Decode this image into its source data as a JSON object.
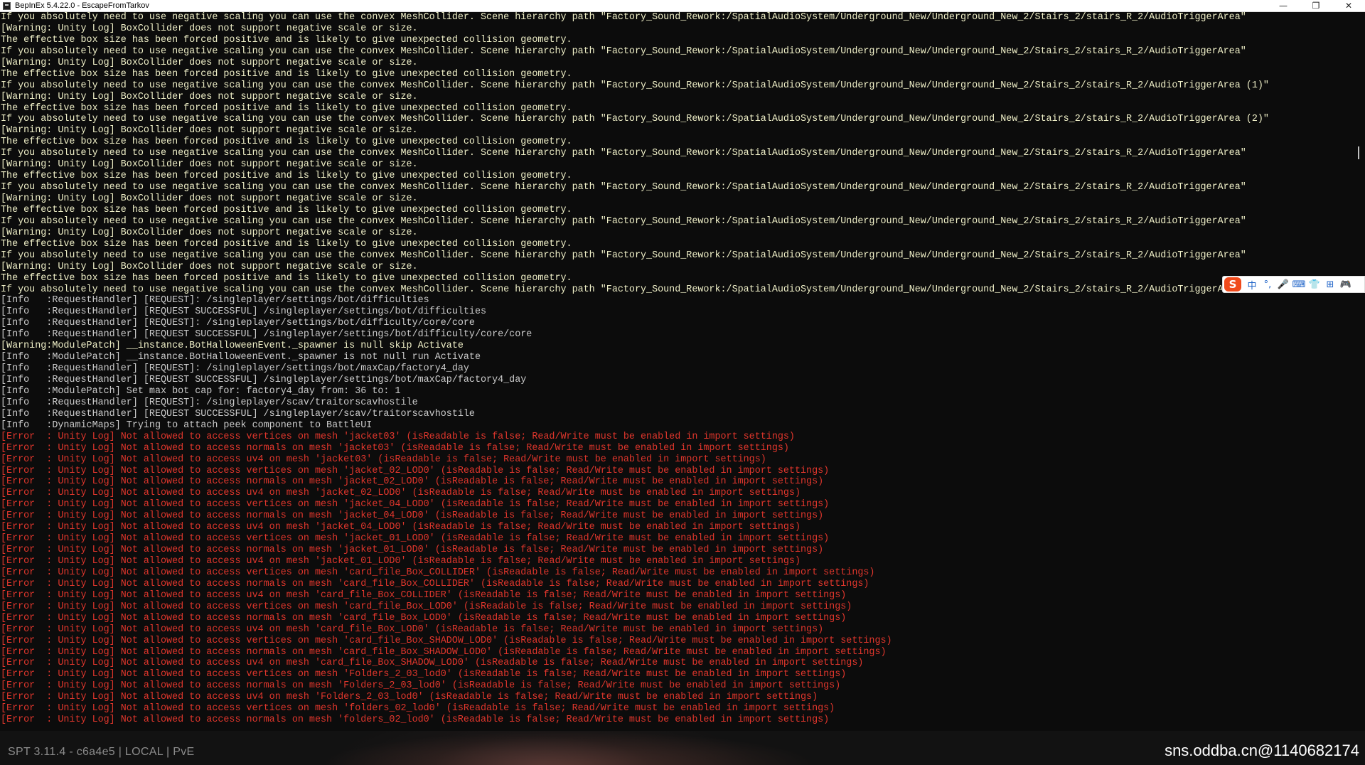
{
  "window": {
    "title": "BepInEx 5.4.22.0 - EscapeFromTarkov",
    "controls": {
      "minimize": "—",
      "restore": "❐",
      "close": "✕"
    }
  },
  "console_lines": [
    {
      "type": "warn",
      "text": "If you absolutely need to use negative scaling you can use the convex MeshCollider. Scene hierarchy path \"Factory_Sound_Rework:/SpatialAudioSystem/Underground_New/Underground_New_2/Stairs_2/stairs_R_2/AudioTriggerArea\""
    },
    {
      "type": "warn",
      "text": "[Warning: Unity Log] BoxCollider does not support negative scale or size."
    },
    {
      "type": "warn",
      "text": "The effective box size has been forced positive and is likely to give unexpected collision geometry."
    },
    {
      "type": "warn",
      "text": "If you absolutely need to use negative scaling you can use the convex MeshCollider. Scene hierarchy path \"Factory_Sound_Rework:/SpatialAudioSystem/Underground_New/Underground_New_2/Stairs_2/stairs_R_2/AudioTriggerArea\""
    },
    {
      "type": "warn",
      "text": "[Warning: Unity Log] BoxCollider does not support negative scale or size."
    },
    {
      "type": "warn",
      "text": "The effective box size has been forced positive and is likely to give unexpected collision geometry."
    },
    {
      "type": "warn",
      "text": "If you absolutely need to use negative scaling you can use the convex MeshCollider. Scene hierarchy path \"Factory_Sound_Rework:/SpatialAudioSystem/Underground_New/Underground_New_2/Stairs_2/stairs_R_2/AudioTriggerArea (1)\""
    },
    {
      "type": "warn",
      "text": "[Warning: Unity Log] BoxCollider does not support negative scale or size."
    },
    {
      "type": "warn",
      "text": "The effective box size has been forced positive and is likely to give unexpected collision geometry."
    },
    {
      "type": "warn",
      "text": "If you absolutely need to use negative scaling you can use the convex MeshCollider. Scene hierarchy path \"Factory_Sound_Rework:/SpatialAudioSystem/Underground_New/Underground_New_2/Stairs_2/stairs_R_2/AudioTriggerArea (2)\""
    },
    {
      "type": "warn",
      "text": "[Warning: Unity Log] BoxCollider does not support negative scale or size."
    },
    {
      "type": "warn",
      "text": "The effective box size has been forced positive and is likely to give unexpected collision geometry."
    },
    {
      "type": "warn",
      "text": "If you absolutely need to use negative scaling you can use the convex MeshCollider. Scene hierarchy path \"Factory_Sound_Rework:/SpatialAudioSystem/Underground_New/Underground_New_2/Stairs_2/stairs_R_2/AudioTriggerArea\""
    },
    {
      "type": "warn",
      "text": "[Warning: Unity Log] BoxCollider does not support negative scale or size."
    },
    {
      "type": "warn",
      "text": "The effective box size has been forced positive and is likely to give unexpected collision geometry."
    },
    {
      "type": "warn",
      "text": "If you absolutely need to use negative scaling you can use the convex MeshCollider. Scene hierarchy path \"Factory_Sound_Rework:/SpatialAudioSystem/Underground_New/Underground_New_2/Stairs_2/stairs_R_2/AudioTriggerArea\""
    },
    {
      "type": "warn",
      "text": "[Warning: Unity Log] BoxCollider does not support negative scale or size."
    },
    {
      "type": "warn",
      "text": "The effective box size has been forced positive and is likely to give unexpected collision geometry."
    },
    {
      "type": "warn",
      "text": "If you absolutely need to use negative scaling you can use the convex MeshCollider. Scene hierarchy path \"Factory_Sound_Rework:/SpatialAudioSystem/Underground_New/Underground_New_2/Stairs_2/stairs_R_2/AudioTriggerArea\""
    },
    {
      "type": "warn",
      "text": "[Warning: Unity Log] BoxCollider does not support negative scale or size."
    },
    {
      "type": "warn",
      "text": "The effective box size has been forced positive and is likely to give unexpected collision geometry."
    },
    {
      "type": "warn",
      "text": "If you absolutely need to use negative scaling you can use the convex MeshCollider. Scene hierarchy path \"Factory_Sound_Rework:/SpatialAudioSystem/Underground_New/Underground_New_2/Stairs_2/stairs_R_2/AudioTriggerArea\""
    },
    {
      "type": "warn",
      "text": "[Warning: Unity Log] BoxCollider does not support negative scale or size."
    },
    {
      "type": "warn",
      "text": "The effective box size has been forced positive and is likely to give unexpected collision geometry."
    },
    {
      "type": "warn",
      "text": "If you absolutely need to use negative scaling you can use the convex MeshCollider. Scene hierarchy path \"Factory_Sound_Rework:/SpatialAudioSystem/Underground_New/Underground_New_2/Stairs_2/stairs_R_2/AudioTriggerArea\""
    },
    {
      "type": "info",
      "text": "[Info   :RequestHandler] [REQUEST]: /singleplayer/settings/bot/difficulties"
    },
    {
      "type": "info",
      "text": "[Info   :RequestHandler] [REQUEST SUCCESSFUL] /singleplayer/settings/bot/difficulties"
    },
    {
      "type": "info",
      "text": "[Info   :RequestHandler] [REQUEST]: /singleplayer/settings/bot/difficulty/core/core"
    },
    {
      "type": "info",
      "text": "[Info   :RequestHandler] [REQUEST SUCCESSFUL] /singleplayer/settings/bot/difficulty/core/core"
    },
    {
      "type": "warn",
      "text": "[Warning:ModulePatch] __instance.BotHalloweenEvent._spawner is null skip Activate"
    },
    {
      "type": "info",
      "text": "[Info   :ModulePatch] __instance.BotHalloweenEvent._spawner is not null run Activate"
    },
    {
      "type": "info",
      "text": "[Info   :RequestHandler] [REQUEST]: /singleplayer/settings/bot/maxCap/factory4_day"
    },
    {
      "type": "info",
      "text": "[Info   :RequestHandler] [REQUEST SUCCESSFUL] /singleplayer/settings/bot/maxCap/factory4_day"
    },
    {
      "type": "info",
      "text": "[Info   :ModulePatch] Set max bot cap for: factory4_day from: 36 to: 1"
    },
    {
      "type": "info",
      "text": "[Info   :RequestHandler] [REQUEST]: /singleplayer/scav/traitorscavhostile"
    },
    {
      "type": "info",
      "text": "[Info   :RequestHandler] [REQUEST SUCCESSFUL] /singleplayer/scav/traitorscavhostile"
    },
    {
      "type": "info",
      "text": "[Info   :DynamicMaps] Trying to attach peek component to BattleUI"
    },
    {
      "type": "err",
      "text": "[Error  : Unity Log] Not allowed to access vertices on mesh 'jacket03' (isReadable is false; Read/Write must be enabled in import settings)"
    },
    {
      "type": "err",
      "text": "[Error  : Unity Log] Not allowed to access normals on mesh 'jacket03' (isReadable is false; Read/Write must be enabled in import settings)"
    },
    {
      "type": "err",
      "text": "[Error  : Unity Log] Not allowed to access uv4 on mesh 'jacket03' (isReadable is false; Read/Write must be enabled in import settings)"
    },
    {
      "type": "err",
      "text": "[Error  : Unity Log] Not allowed to access vertices on mesh 'jacket_02_LOD0' (isReadable is false; Read/Write must be enabled in import settings)"
    },
    {
      "type": "err",
      "text": "[Error  : Unity Log] Not allowed to access normals on mesh 'jacket_02_LOD0' (isReadable is false; Read/Write must be enabled in import settings)"
    },
    {
      "type": "err",
      "text": "[Error  : Unity Log] Not allowed to access uv4 on mesh 'jacket_02_LOD0' (isReadable is false; Read/Write must be enabled in import settings)"
    },
    {
      "type": "err",
      "text": "[Error  : Unity Log] Not allowed to access vertices on mesh 'jacket_04_LOD0' (isReadable is false; Read/Write must be enabled in import settings)"
    },
    {
      "type": "err",
      "text": "[Error  : Unity Log] Not allowed to access normals on mesh 'jacket_04_LOD0' (isReadable is false; Read/Write must be enabled in import settings)"
    },
    {
      "type": "err",
      "text": "[Error  : Unity Log] Not allowed to access uv4 on mesh 'jacket_04_LOD0' (isReadable is false; Read/Write must be enabled in import settings)"
    },
    {
      "type": "err",
      "text": "[Error  : Unity Log] Not allowed to access vertices on mesh 'jacket_01_LOD0' (isReadable is false; Read/Write must be enabled in import settings)"
    },
    {
      "type": "err",
      "text": "[Error  : Unity Log] Not allowed to access normals on mesh 'jacket_01_LOD0' (isReadable is false; Read/Write must be enabled in import settings)"
    },
    {
      "type": "err",
      "text": "[Error  : Unity Log] Not allowed to access uv4 on mesh 'jacket_01_LOD0' (isReadable is false; Read/Write must be enabled in import settings)"
    },
    {
      "type": "err",
      "text": "[Error  : Unity Log] Not allowed to access vertices on mesh 'card_file_Box_COLLIDER' (isReadable is false; Read/Write must be enabled in import settings)"
    },
    {
      "type": "err",
      "text": "[Error  : Unity Log] Not allowed to access normals on mesh 'card_file_Box_COLLIDER' (isReadable is false; Read/Write must be enabled in import settings)"
    },
    {
      "type": "err",
      "text": "[Error  : Unity Log] Not allowed to access uv4 on mesh 'card_file_Box_COLLIDER' (isReadable is false; Read/Write must be enabled in import settings)"
    },
    {
      "type": "err",
      "text": "[Error  : Unity Log] Not allowed to access vertices on mesh 'card_file_Box_LOD0' (isReadable is false; Read/Write must be enabled in import settings)"
    },
    {
      "type": "err",
      "text": "[Error  : Unity Log] Not allowed to access normals on mesh 'card_file_Box_LOD0' (isReadable is false; Read/Write must be enabled in import settings)"
    },
    {
      "type": "err",
      "text": "[Error  : Unity Log] Not allowed to access uv4 on mesh 'card_file_Box_LOD0' (isReadable is false; Read/Write must be enabled in import settings)"
    },
    {
      "type": "err",
      "text": "[Error  : Unity Log] Not allowed to access vertices on mesh 'card_file_Box_SHADOW_LOD0' (isReadable is false; Read/Write must be enabled in import settings)"
    },
    {
      "type": "err",
      "text": "[Error  : Unity Log] Not allowed to access normals on mesh 'card_file_Box_SHADOW_LOD0' (isReadable is false; Read/Write must be enabled in import settings)"
    },
    {
      "type": "err",
      "text": "[Error  : Unity Log] Not allowed to access uv4 on mesh 'card_file_Box_SHADOW_LOD0' (isReadable is false; Read/Write must be enabled in import settings)"
    },
    {
      "type": "err",
      "text": "[Error  : Unity Log] Not allowed to access vertices on mesh 'Folders_2_03_lod0' (isReadable is false; Read/Write must be enabled in import settings)"
    },
    {
      "type": "err",
      "text": "[Error  : Unity Log] Not allowed to access normals on mesh 'Folders_2_03_lod0' (isReadable is false; Read/Write must be enabled in import settings)"
    },
    {
      "type": "err",
      "text": "[Error  : Unity Log] Not allowed to access uv4 on mesh 'Folders_2_03_lod0' (isReadable is false; Read/Write must be enabled in import settings)"
    },
    {
      "type": "err",
      "text": "[Error  : Unity Log] Not allowed to access vertices on mesh 'folders_02_lod0' (isReadable is false; Read/Write must be enabled in import settings)"
    },
    {
      "type": "err",
      "text": "[Error  : Unity Log] Not allowed to access normals on mesh 'folders_02_lod0' (isReadable is false; Read/Write must be enabled in import settings)"
    }
  ],
  "ime_toolbar": {
    "logo": "S",
    "items": [
      {
        "name": "chinese-mode",
        "label": "中"
      },
      {
        "name": "punctuation",
        "label": "°,"
      },
      {
        "name": "voice",
        "label": "🎤"
      },
      {
        "name": "keyboard",
        "label": "⌨"
      },
      {
        "name": "skin",
        "label": "👕"
      },
      {
        "name": "toolbox",
        "label": "⊞"
      },
      {
        "name": "game",
        "label": "🎮"
      }
    ]
  },
  "footer": {
    "spt_version": "SPT 3.11.4 - c6a4e5 | LOCAL | PvE",
    "watermark": "sns.oddba.cn@1140682174"
  },
  "colors": {
    "warn": "#f0f0c8",
    "info": "#cccccc",
    "error": "#e0362c",
    "background": "#0c0c0c"
  }
}
